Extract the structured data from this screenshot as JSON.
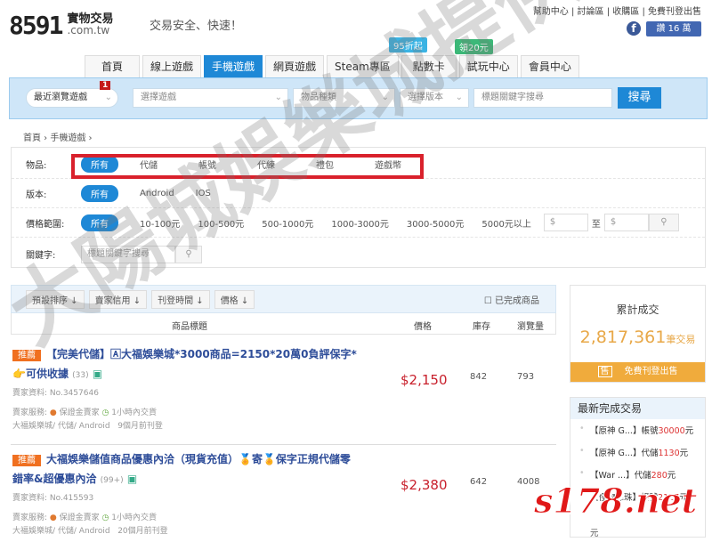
{
  "header": {
    "logo_num": "8591",
    "logo_name": "實物交易",
    "logo_domain": ".com.tw",
    "slogan": "交易安全、快速！",
    "toplinks": [
      "幫助中心",
      "討論區",
      "收購區",
      "免費刊登出售"
    ],
    "fb_like": "讚 16 萬"
  },
  "tabs": [
    {
      "label": "首頁"
    },
    {
      "label": "線上遊戲"
    },
    {
      "label": "手機遊戲",
      "active": true
    },
    {
      "label": "網頁遊戲"
    },
    {
      "label": "Steam專區"
    },
    {
      "label": "點數卡",
      "badge": "95折起",
      "badge_color": "#3bb3e3"
    },
    {
      "label": "試玩中心",
      "badge": "領20元",
      "badge_color": "#3cb878"
    },
    {
      "label": "會員中心"
    }
  ],
  "search": {
    "recent": "最近瀏覽遊戲",
    "recent_count": "1",
    "game": "選擇遊戲",
    "type": "物品種類",
    "version": "選擇版本",
    "keyword_placeholder": "標題關鍵字搜尋",
    "button": "搜尋"
  },
  "breadcrumb": [
    "首頁",
    "手機遊戲"
  ],
  "filters": {
    "item": {
      "label": "物品:",
      "options": [
        "所有",
        "代儲",
        "帳號",
        "代練",
        "禮包",
        "遊戲幣"
      ]
    },
    "version": {
      "label": "版本:",
      "options": [
        "所有",
        "Android",
        "IOS"
      ]
    },
    "price": {
      "label": "價格範圍:",
      "options": [
        "所有",
        "10-100元",
        "100-500元",
        "500-1000元",
        "1000-3000元",
        "3000-5000元",
        "5000元以上"
      ],
      "from": "$",
      "to_label": "至",
      "to": "$"
    },
    "keyword": {
      "label": "關鍵字:",
      "placeholder": "標題關鍵字搜尋"
    }
  },
  "sort": {
    "buttons": [
      "預設排序",
      "賣家信用",
      "刊登時間",
      "價格"
    ],
    "completed": "已完成商品"
  },
  "columns": {
    "title": "商品標題",
    "price": "價格",
    "stock": "庫存",
    "views": "瀏覽量"
  },
  "items": [
    {
      "tag": "推薦",
      "title": "【完美代儲】🄰大福娛樂城*3000商品=2150*20萬0負評保字*👉可供收據",
      "count": "(33)",
      "seller": "賣家資料: No.3457646",
      "service": "賣家服務:",
      "guarantee": "保證金賣家",
      "delivery": "1小時內交貨",
      "info": "大福娛樂城/ 代儲/ Android",
      "posted": "9個月前刊登",
      "price": "$2,150",
      "stock": "842",
      "views": "793"
    },
    {
      "tag": "推薦",
      "title": "大福娛樂儲值商品優惠內洽（現貨充值）🏅寄🏅保字正規代儲零錯率&超優惠內洽",
      "count": "(99+)",
      "seller": "賣家資料: No.415593",
      "service": "賣家服務:",
      "guarantee": "保證金賣家",
      "delivery": "1小時內交貨",
      "info": "大福娛樂城/ 代儲/ Android",
      "posted": "20個月前刊登",
      "price": "$2,380",
      "stock": "642",
      "views": "4008"
    }
  ],
  "stats": {
    "title": "累計成交",
    "count": "2,817,361",
    "unit": "筆交易",
    "sell_icon": "售",
    "sell_button": "免費刊登出售"
  },
  "recent": {
    "title": "最新完成交易",
    "items": [
      {
        "game": "【原神 G...】",
        "type": "帳號",
        "amount": "30000",
        "unit": "元"
      },
      {
        "game": "【原神 G...】",
        "type": "代儲",
        "amount": "1130",
        "unit": "元"
      },
      {
        "game": "【War ...】",
        "type": "代儲",
        "amount": "280",
        "unit": "元"
      },
      {
        "game": "【怪物彈珠】",
        "type": "帳號",
        "amount": "2127",
        "unit": "元"
      }
    ],
    "trailing": "元"
  },
  "watermarks": {
    "text": "大陽城娛樂城提供",
    "logo": "s178.net"
  }
}
